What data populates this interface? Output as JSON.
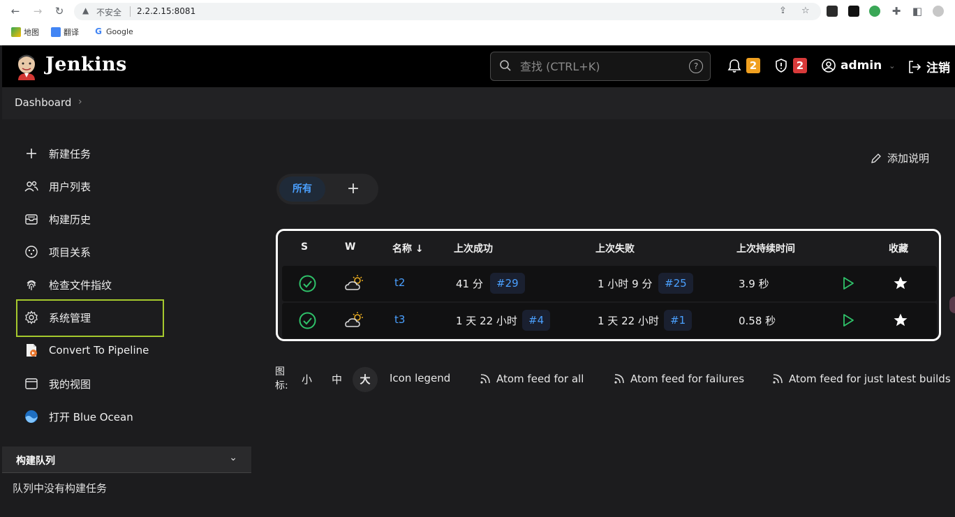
{
  "browser": {
    "insecure_label": "不安全",
    "url": "2.2.2.15:8081",
    "bookmarks": [
      {
        "label": "地图"
      },
      {
        "label": "翻译"
      },
      {
        "label": "Google"
      }
    ]
  },
  "header": {
    "brand": "Jenkins",
    "search_placeholder": "查找 (CTRL+K)",
    "help": "?",
    "notifications_count": "2",
    "security_count": "2",
    "user": "admin",
    "logout": "注销"
  },
  "breadcrumb": {
    "item": "Dashboard",
    "chevron": "›"
  },
  "sidebar": {
    "items": [
      {
        "label": "新建任务",
        "icon": "plus-icon"
      },
      {
        "label": "用户列表",
        "icon": "users-icon"
      },
      {
        "label": "构建历史",
        "icon": "history-icon"
      },
      {
        "label": "项目关系",
        "icon": "relationship-icon"
      },
      {
        "label": "检查文件指纹",
        "icon": "fingerprint-icon"
      },
      {
        "label": "系统管理",
        "icon": "gear-icon"
      },
      {
        "label": "Convert To Pipeline",
        "icon": "pipeline-icon"
      },
      {
        "label": "我的视图",
        "icon": "window-icon"
      },
      {
        "label": "打开 Blue Ocean",
        "icon": "blue-ocean-icon"
      }
    ],
    "queue": {
      "title": "构建队列",
      "empty": "队列中没有构建任务"
    }
  },
  "main": {
    "add_description": "添加说明",
    "tabs": [
      {
        "label": "所有"
      }
    ],
    "add_tab": "+",
    "table": {
      "headers": {
        "s": "S",
        "w": "W",
        "name": "名称 ↓",
        "last_success": "上次成功",
        "last_failure": "上次失败",
        "last_duration": "上次持续时间",
        "fav": "收藏"
      },
      "rows": [
        {
          "name": "t2",
          "last_success": "41 分",
          "success_build": "#29",
          "last_failure": "1 小时 9 分",
          "failure_build": "#25",
          "duration": "3.9 秒"
        },
        {
          "name": "t3",
          "last_success": "1 天 22 小时",
          "success_build": "#4",
          "last_failure": "1 天 22 小时",
          "failure_build": "#1",
          "duration": "0.58 秒"
        }
      ]
    },
    "legend": {
      "label": "图标:",
      "sizes": [
        "小",
        "中",
        "大"
      ],
      "icon_legend": "Icon legend",
      "feeds": [
        "Atom feed for all",
        "Atom feed for failures",
        "Atom feed for just latest builds"
      ]
    }
  },
  "colors": {
    "accent_link": "#4aa0ff",
    "success_green": "#2fc36a",
    "highlight_border": "#a6c92d",
    "notification_badge": "#f0a020",
    "security_badge": "#d83a3a"
  }
}
